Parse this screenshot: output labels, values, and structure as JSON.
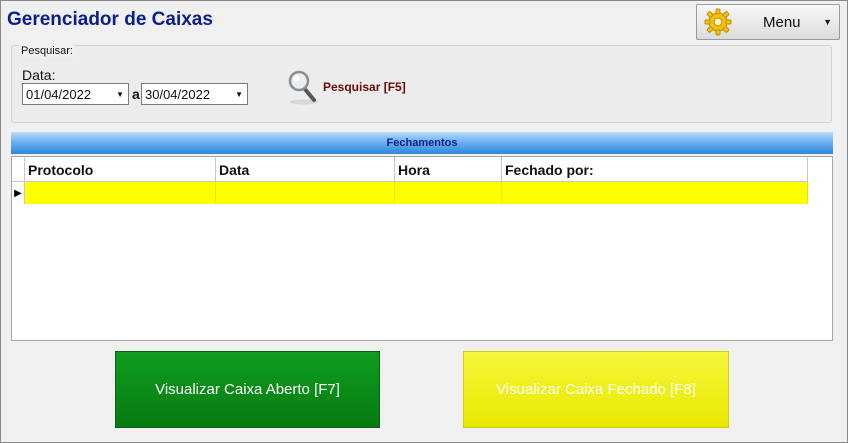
{
  "window": {
    "title": "Gerenciador de Caixas"
  },
  "menu": {
    "label": "Menu",
    "icon": "gear-icon"
  },
  "search": {
    "legend": "Pesquisar:",
    "date_label": "Data:",
    "date_from": "01/04/2022",
    "separator": "a",
    "date_to": "30/04/2022",
    "button_label": "Pesquisar [F5]",
    "button_icon": "magnifier-icon"
  },
  "section": {
    "title": "Fechamentos"
  },
  "table": {
    "columns": [
      "Protocolo",
      "Data",
      "Hora",
      "Fechado por:"
    ],
    "rows": [
      [
        "",
        "",
        "",
        ""
      ]
    ],
    "selected_row_color": "#ffff00"
  },
  "actions": {
    "open_label": "Visualizar Caixa Aberto [F7]",
    "open_color": "#0a8c18",
    "closed_label": "Visualizar Caixa Fechado [F8]",
    "closed_color": "#eeee10"
  }
}
